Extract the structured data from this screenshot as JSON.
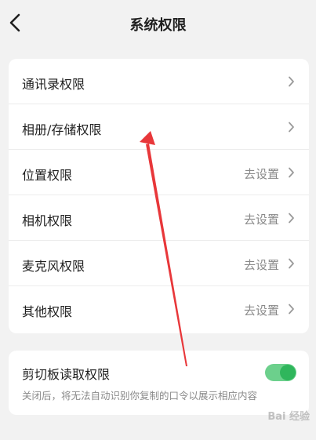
{
  "header": {
    "title": "系统权限"
  },
  "permissions": [
    {
      "label": "通讯录权限",
      "value": ""
    },
    {
      "label": "相册/存储权限",
      "value": ""
    },
    {
      "label": "位置权限",
      "value": "去设置"
    },
    {
      "label": "相机权限",
      "value": "去设置"
    },
    {
      "label": "麦克风权限",
      "value": "去设置"
    },
    {
      "label": "其他权限",
      "value": "去设置"
    }
  ],
  "clipboard": {
    "title": "剪切板读取权限",
    "description": "关闭后，将无法自动识别你复制的口令以展示相应内容",
    "enabled": true
  },
  "icons": {
    "back": "chevron-left-icon",
    "row": "chevron-right-icon"
  },
  "colors": {
    "toggle_track": "#6cd08c",
    "toggle_knob": "#2fb65c",
    "annotation_arrow": "#e8373a"
  },
  "watermark": "Bai 经验"
}
